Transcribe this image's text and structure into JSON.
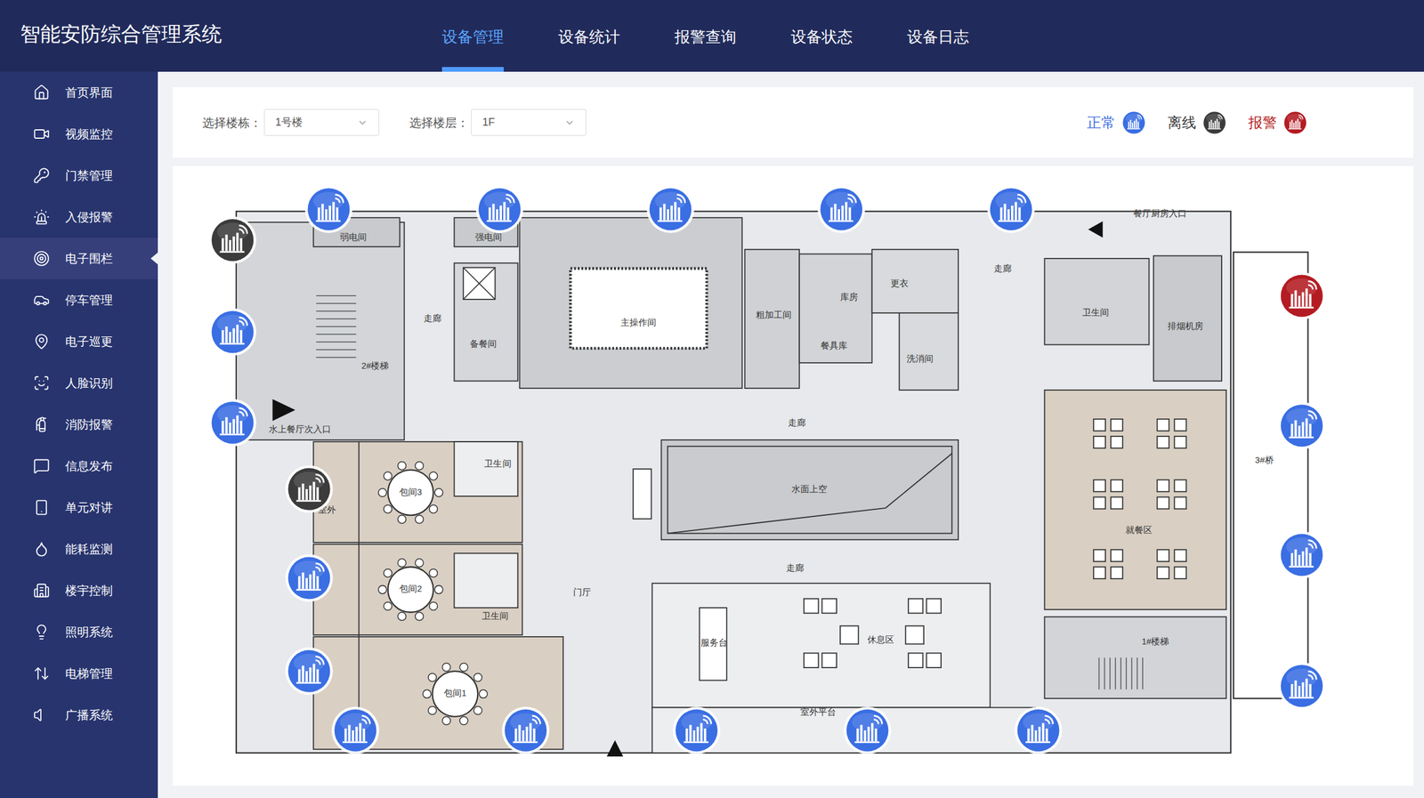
{
  "app": {
    "title": "智能安防综合管理系统"
  },
  "tabs": [
    {
      "label": "设备管理",
      "selected": true
    },
    {
      "label": "设备统计",
      "selected": false
    },
    {
      "label": "报警查询",
      "selected": false
    },
    {
      "label": "设备状态",
      "selected": false
    },
    {
      "label": "设备日志",
      "selected": false
    }
  ],
  "sidebar": {
    "items": [
      {
        "label": "首页界面",
        "selected": false
      },
      {
        "label": "视频监控",
        "selected": false
      },
      {
        "label": "门禁管理",
        "selected": false
      },
      {
        "label": "入侵报警",
        "selected": false
      },
      {
        "label": "电子围栏",
        "selected": true
      },
      {
        "label": "停车管理",
        "selected": false
      },
      {
        "label": "电子巡更",
        "selected": false
      },
      {
        "label": "人脸识别",
        "selected": false
      },
      {
        "label": "消防报警",
        "selected": false
      },
      {
        "label": "信息发布",
        "selected": false
      },
      {
        "label": "单元对讲",
        "selected": false
      },
      {
        "label": "能耗监测",
        "selected": false
      },
      {
        "label": "楼宇控制",
        "selected": false
      },
      {
        "label": "照明系统",
        "selected": false
      },
      {
        "label": "电梯管理",
        "selected": false
      },
      {
        "label": "广播系统",
        "selected": false
      }
    ]
  },
  "filters": [
    {
      "label": "选择楼栋：",
      "value": "1号楼"
    },
    {
      "label": "选择楼层：",
      "value": "1F"
    }
  ],
  "legend": [
    {
      "label": "正常",
      "status": "normal",
      "color": "#3a6ee3"
    },
    {
      "label": "离线",
      "status": "offline",
      "color": "#3b3b3b"
    },
    {
      "label": "报警",
      "status": "alarm",
      "color": "#b31c22"
    }
  ],
  "floor_plan": {
    "rooms": [
      "弱电间",
      "强电间",
      "主操作间",
      "走廊",
      "备餐间",
      "2#楼梯",
      "水上餐厅次入口",
      "粗加工间",
      "库房",
      "更衣",
      "餐具库",
      "洗消间",
      "餐厅厨房入口",
      "走廊",
      "卫生间",
      "排烟机房",
      "走廊",
      "水面上空",
      "3#桥",
      "就餐区",
      "包间3",
      "卫生间",
      "室外",
      "包间2",
      "卫生间",
      "包间1",
      "门厅",
      "走廊",
      "服务台",
      "休息区",
      "1#楼梯",
      "室外平台"
    ]
  },
  "devices": [
    {
      "status": "normal"
    },
    {
      "status": "normal"
    },
    {
      "status": "normal"
    },
    {
      "status": "normal"
    },
    {
      "status": "normal"
    },
    {
      "status": "offline"
    },
    {
      "status": "normal"
    },
    {
      "status": "normal"
    },
    {
      "status": "offline"
    },
    {
      "status": "normal"
    },
    {
      "status": "normal"
    },
    {
      "status": "normal"
    },
    {
      "status": "normal"
    },
    {
      "status": "normal"
    },
    {
      "status": "normal"
    },
    {
      "status": "normal"
    },
    {
      "status": "alarm"
    },
    {
      "status": "normal"
    },
    {
      "status": "normal"
    },
    {
      "status": "normal"
    }
  ]
}
